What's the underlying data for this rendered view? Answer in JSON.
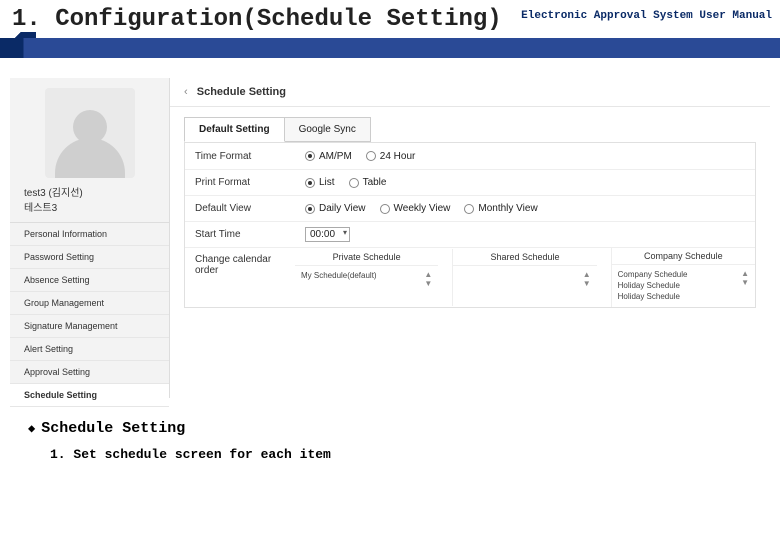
{
  "header": {
    "title": "1. Configuration(Schedule Setting)",
    "right": "Electronic Approval System User Manual"
  },
  "sidebar": {
    "user_name": "test3 (김지선)",
    "user_sub": "테스트3",
    "items": [
      "Personal Information",
      "Password Setting",
      "Absence Setting",
      "Group Management",
      "Signature Management",
      "Alert Setting",
      "Approval Setting",
      "Schedule Setting"
    ],
    "active_index": 7
  },
  "breadcrumb": {
    "chev": "‹",
    "label": "Schedule Setting"
  },
  "tabs": [
    {
      "label": "Default Setting",
      "active": true
    },
    {
      "label": "Google Sync",
      "active": false
    }
  ],
  "rows": {
    "time_format": {
      "label": "Time Format",
      "options": [
        "AM/PM",
        "24 Hour"
      ],
      "selected": 0
    },
    "print_format": {
      "label": "Print Format",
      "options": [
        "List",
        "Table"
      ],
      "selected": 0
    },
    "default_view": {
      "label": "Default View",
      "options": [
        "Daily View",
        "Weekly View",
        "Monthly View"
      ],
      "selected": 0
    },
    "start_time": {
      "label": "Start Time",
      "value": "00:00"
    },
    "change_order": {
      "label": "Change calendar order"
    }
  },
  "calendars": {
    "private": {
      "head": "Private Schedule",
      "item": "My Schedule(default)"
    },
    "shared": {
      "head": "Shared Schedule",
      "item": ""
    },
    "company": {
      "head": "Company Schedule",
      "items": [
        "Company Schedule",
        "Holiday Schedule",
        "Holiday Schedule"
      ]
    }
  },
  "notes": {
    "title": "Schedule Setting",
    "line1": "1. Set schedule screen for each item"
  }
}
